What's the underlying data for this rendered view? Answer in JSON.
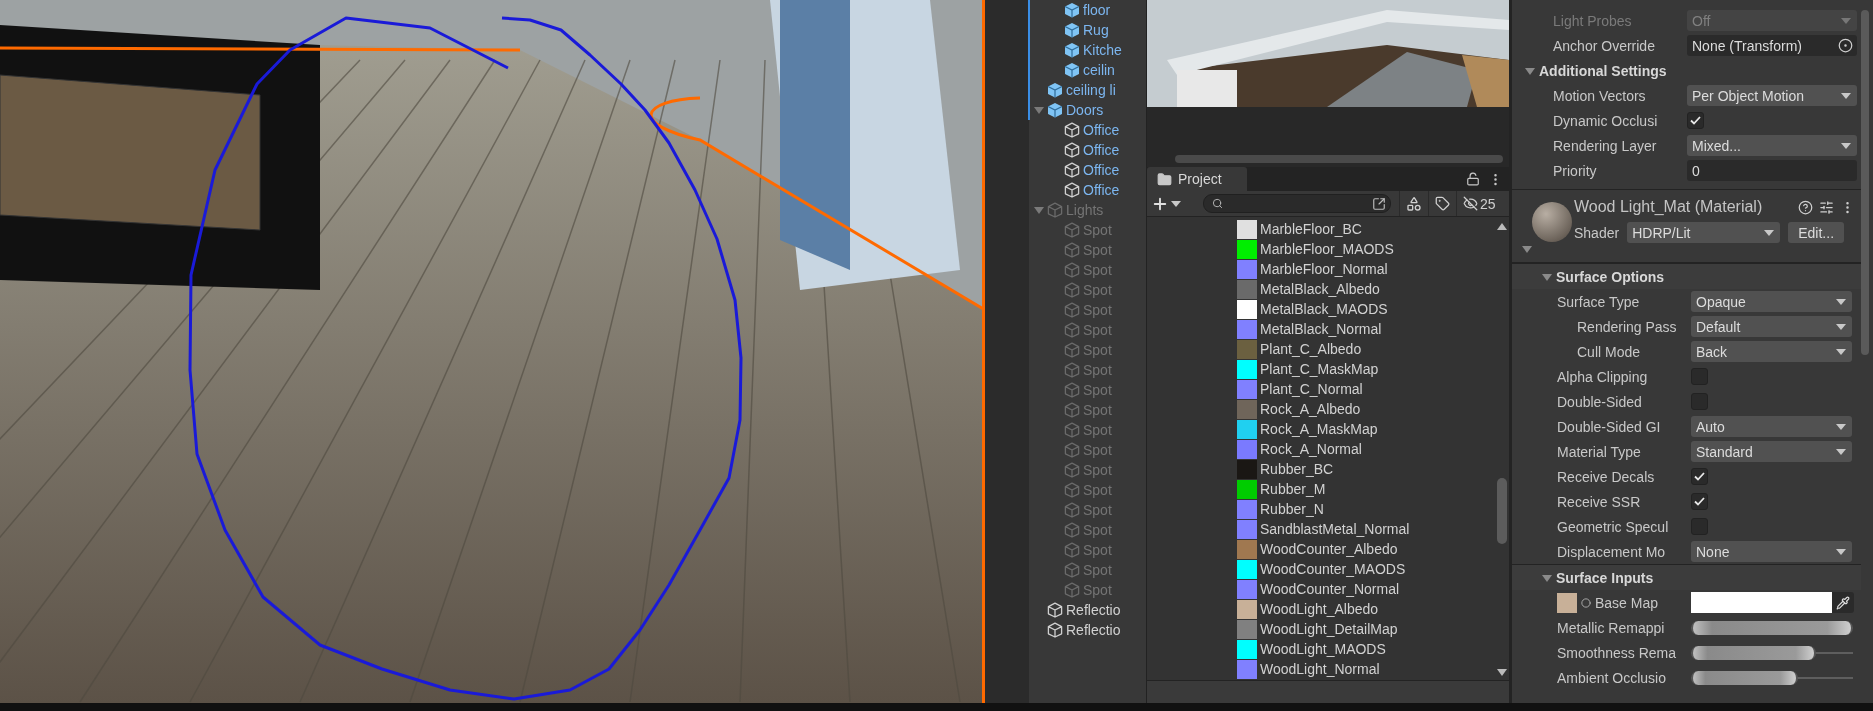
{
  "hierarchy": {
    "tail_of_previous_group": [
      {
        "label": "floor",
        "kind": "prefab-root",
        "overridden": true,
        "disabled": false
      },
      {
        "label": "Rug",
        "kind": "prefab-root",
        "overridden": true,
        "disabled": false
      },
      {
        "label": "Kitche",
        "kind": "prefab-root",
        "overridden": true,
        "disabled": false
      },
      {
        "label": "ceilin",
        "kind": "prefab-root",
        "overridden": true,
        "disabled": false
      }
    ],
    "items": [
      {
        "label": "ceiling li",
        "kind": "prefab-root",
        "overridden": true,
        "disabled": false
      },
      {
        "label": "Doors",
        "kind": "prefab-root",
        "overridden": true,
        "disabled": false,
        "expanded": true,
        "children": [
          {
            "label": "Office",
            "kind": "prefab-child",
            "overridden": false,
            "disabled": false
          },
          {
            "label": "Office",
            "kind": "prefab-child",
            "overridden": false,
            "disabled": false
          },
          {
            "label": "Office",
            "kind": "prefab-child",
            "overridden": false,
            "disabled": false
          },
          {
            "label": "Office",
            "kind": "prefab-child",
            "overridden": false,
            "disabled": false
          }
        ]
      },
      {
        "label": "Lights",
        "kind": "object",
        "overridden": false,
        "disabled": true,
        "expanded": true,
        "children": [
          {
            "label": "Spot",
            "kind": "object",
            "overridden": false,
            "disabled": true
          },
          {
            "label": "Spot",
            "kind": "object",
            "overridden": false,
            "disabled": true
          },
          {
            "label": "Spot",
            "kind": "object",
            "overridden": false,
            "disabled": true
          },
          {
            "label": "Spot",
            "kind": "object",
            "overridden": false,
            "disabled": true
          },
          {
            "label": "Spot",
            "kind": "object",
            "overridden": false,
            "disabled": true
          },
          {
            "label": "Spot",
            "kind": "object",
            "overridden": false,
            "disabled": true
          },
          {
            "label": "Spot",
            "kind": "object",
            "overridden": false,
            "disabled": true
          },
          {
            "label": "Spot",
            "kind": "object",
            "overridden": false,
            "disabled": true
          },
          {
            "label": "Spot",
            "kind": "object",
            "overridden": false,
            "disabled": true
          },
          {
            "label": "Spot",
            "kind": "object",
            "overridden": false,
            "disabled": true
          },
          {
            "label": "Spot",
            "kind": "object",
            "overridden": false,
            "disabled": true
          },
          {
            "label": "Spot",
            "kind": "object",
            "overridden": false,
            "disabled": true
          },
          {
            "label": "Spot",
            "kind": "object",
            "overridden": false,
            "disabled": true
          },
          {
            "label": "Spot",
            "kind": "object",
            "overridden": false,
            "disabled": true
          },
          {
            "label": "Spot",
            "kind": "object",
            "overridden": false,
            "disabled": true
          },
          {
            "label": "Spot",
            "kind": "object",
            "overridden": false,
            "disabled": true
          },
          {
            "label": "Spot",
            "kind": "object",
            "overridden": false,
            "disabled": true
          },
          {
            "label": "Spot",
            "kind": "object",
            "overridden": false,
            "disabled": true
          },
          {
            "label": "Spot",
            "kind": "object",
            "overridden": false,
            "disabled": true
          }
        ]
      },
      {
        "label": "Reflectio",
        "kind": "object",
        "overridden": false,
        "disabled": false
      },
      {
        "label": "Reflectio",
        "kind": "object",
        "overridden": false,
        "disabled": false
      }
    ]
  },
  "project": {
    "tab": "Project",
    "hidden_count": "25",
    "assets": [
      {
        "name": "MarbleFloor_BC",
        "color": "#e0e0e0"
      },
      {
        "name": "MarbleFloor_MAODS",
        "color": "#00ee00"
      },
      {
        "name": "MarbleFloor_Normal",
        "color": "#8080ff"
      },
      {
        "name": "MetalBlack_Albedo",
        "color": "#6a6a6a"
      },
      {
        "name": "MetalBlack_MAODS",
        "color": "#ffffff"
      },
      {
        "name": "MetalBlack_Normal",
        "color": "#8080ff"
      },
      {
        "name": "Plant_C_Albedo",
        "color": "#6b6040"
      },
      {
        "name": "Plant_C_MaskMap",
        "color": "#00ffff"
      },
      {
        "name": "Plant_C_Normal",
        "color": "#8080ff"
      },
      {
        "name": "Rock_A_Albedo",
        "color": "#6f655a"
      },
      {
        "name": "Rock_A_MaskMap",
        "color": "#20d0f0"
      },
      {
        "name": "Rock_A_Normal",
        "color": "#7a7aff"
      },
      {
        "name": "Rubber_BC",
        "color": "#1a1714"
      },
      {
        "name": "Rubber_M",
        "color": "#00cc00"
      },
      {
        "name": "Rubber_N",
        "color": "#8080ff"
      },
      {
        "name": "SandblastMetal_Normal",
        "color": "#8080ff"
      },
      {
        "name": "WoodCounter_Albedo",
        "color": "#a07850"
      },
      {
        "name": "WoodCounter_MAODS",
        "color": "#00ffff"
      },
      {
        "name": "WoodCounter_Normal",
        "color": "#8080ff"
      },
      {
        "name": "WoodLight_Albedo",
        "color": "#c8b098"
      },
      {
        "name": "WoodLight_DetailMap",
        "color": "#808080"
      },
      {
        "name": "WoodLight_MAODS",
        "color": "#00ffff"
      },
      {
        "name": "WoodLight_Normal",
        "color": "#8080ff"
      }
    ]
  },
  "inspector": {
    "probe_rows": [
      {
        "label": "Light Probes",
        "kind": "dropdown",
        "value": "Off",
        "disabled": true
      },
      {
        "label": "Anchor Override",
        "kind": "object",
        "value": "None (Transform)"
      }
    ],
    "additional_settings": {
      "title": "Additional Settings",
      "expanded": true,
      "rows": [
        {
          "label": "Motion Vectors",
          "kind": "dropdown",
          "value": "Per Object Motion"
        },
        {
          "label": "Dynamic Occlusi",
          "kind": "checkbox",
          "checked": true
        },
        {
          "label": "Rendering Layer",
          "kind": "dropdown",
          "value": "Mixed..."
        },
        {
          "label": "Priority",
          "kind": "number",
          "value": "0"
        }
      ]
    },
    "material": {
      "title": "Wood Light_Mat (Material)",
      "shader_label": "Shader",
      "shader": "HDRP/Lit",
      "edit_button": "Edit...",
      "expanded": true
    },
    "material_sections": [
      {
        "title": "Surface Options",
        "expanded": true,
        "rows": [
          {
            "label": "Surface Type",
            "kind": "dropdown",
            "value": "Opaque",
            "children": [
              {
                "label": "Rendering Pass",
                "kind": "dropdown",
                "value": "Default"
              },
              {
                "label": "Cull Mode",
                "kind": "dropdown",
                "value": "Back"
              }
            ]
          },
          {
            "label": "Alpha Clipping",
            "kind": "checkbox",
            "checked": false
          },
          {
            "label": "Double-Sided",
            "kind": "checkbox",
            "checked": false
          },
          {
            "label": "Double-Sided GI",
            "kind": "dropdown",
            "value": "Auto"
          },
          {
            "label": "Material Type",
            "kind": "dropdown",
            "value": "Standard"
          },
          {
            "label": "Receive Decals",
            "kind": "checkbox",
            "checked": true
          },
          {
            "label": "Receive SSR",
            "kind": "checkbox",
            "checked": true
          },
          {
            "label": "Geometric Specul",
            "kind": "checkbox",
            "checked": false
          },
          {
            "label": "Displacement Mo",
            "kind": "dropdown",
            "value": "None"
          }
        ]
      },
      {
        "title": "Surface Inputs",
        "expanded": true,
        "rows": [
          {
            "label": "Base Map",
            "kind": "texture"
          },
          {
            "label": "Metallic Remappi",
            "kind": "range",
            "level": 1
          },
          {
            "label": "Smoothness Rema",
            "kind": "range",
            "level": 0.77
          },
          {
            "label": "Ambient Occlusio",
            "kind": "range",
            "level": 0.66
          }
        ]
      }
    ]
  }
}
